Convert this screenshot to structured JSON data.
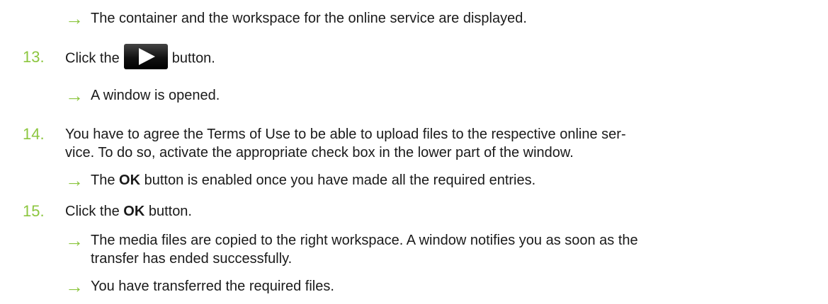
{
  "accent_color": "#8cc63f",
  "icons": {
    "arrow": "right-arrow-icon",
    "play": "play-icon"
  },
  "result_0": "The container and the workspace for the online service are displayed.",
  "steps": [
    {
      "number": "13.",
      "text_before": "Click the",
      "text_after": "button.",
      "results": [
        "A window is opened."
      ]
    },
    {
      "number": "14.",
      "lines": [
        "You have to agree the Terms of Use to be able to upload files to the respective online ser-",
        "vice. To do so, activate the appropriate check box in the lower part of the window."
      ],
      "result_prefix": "The",
      "result_bold": "OK",
      "result_suffix": "button is enabled once you have made all the required entries."
    },
    {
      "number": "15.",
      "text_before": "Click the",
      "text_bold": "OK",
      "text_after": "button.",
      "results": [
        "The media files are copied to the right workspace. A window notifies you as soon as the",
        "transfer has ended successfully.",
        "You have transferred the required files."
      ]
    }
  ]
}
